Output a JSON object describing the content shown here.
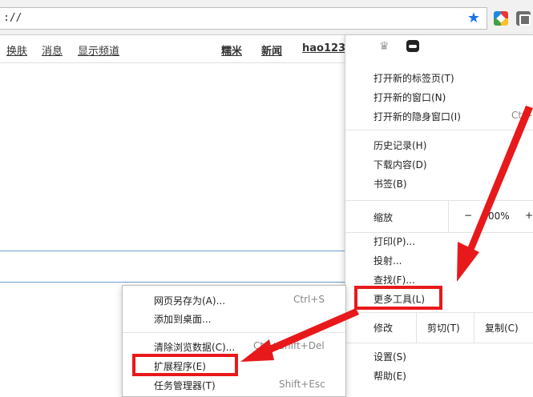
{
  "address_bar": {
    "url": "://"
  },
  "nav": {
    "left_links": [
      "换肤",
      "消息",
      "显示频道"
    ],
    "right_links": [
      "糯米",
      "新闻",
      "hao123"
    ]
  },
  "chrome_menu": {
    "items_group1": [
      {
        "label": "打开新的标签页(T)"
      },
      {
        "label": "打开新的窗口(N)"
      },
      {
        "label": "打开新的隐身窗口(I)",
        "shortcut": "Ctrl-"
      }
    ],
    "items_group2": [
      {
        "label": "历史记录(H)"
      },
      {
        "label": "下载内容(D)"
      },
      {
        "label": "书签(B)"
      }
    ],
    "zoom": {
      "label": "缩放",
      "minus": "−",
      "value": "00%",
      "plus": "+"
    },
    "items_group3": [
      {
        "label": "打印(P)..."
      },
      {
        "label": "投射..."
      },
      {
        "label": "查找(F)..."
      },
      {
        "label": "更多工具(L)"
      }
    ],
    "edit": {
      "label": "修改",
      "cut": "剪切(T)",
      "copy": "复制(C)"
    },
    "items_group4": [
      {
        "label": "设置(S)"
      },
      {
        "label": "帮助(E)"
      }
    ]
  },
  "submenu": {
    "items": [
      {
        "label": "网页另存为(A)...",
        "shortcut": "Ctrl+S"
      },
      {
        "label": "添加到桌面..."
      },
      {
        "label": "清除浏览数据(C)...",
        "shortcut": "Ctrl+Shift+Del"
      },
      {
        "label": "扩展程序(E)"
      },
      {
        "label": "任务管理器(T)",
        "shortcut": "Shift+Esc"
      }
    ]
  },
  "colors": {
    "highlight": "#e8191b",
    "star": "#1a73e8",
    "rule": "#6a9fd4"
  }
}
